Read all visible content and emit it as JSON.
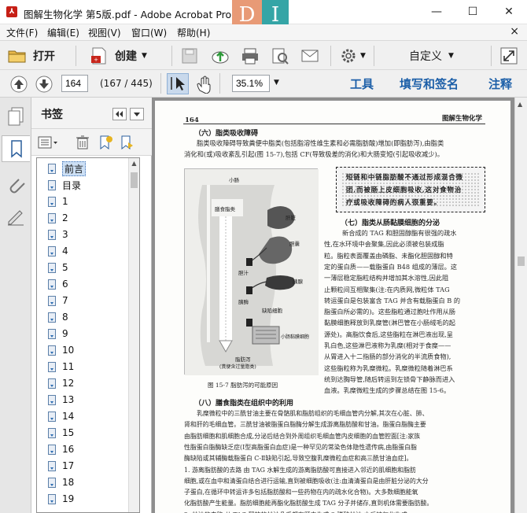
{
  "window": {
    "title": "图解生物化学 第5版.pdf - Adobe Acrobat Pro",
    "deco_left": "D",
    "deco_right": "I",
    "minimize": "—",
    "maximize": "☐",
    "close": "✕"
  },
  "menu": {
    "items": [
      "文件(F)",
      "编辑(E)",
      "视图(V)",
      "窗口(W)",
      "帮助(H)"
    ],
    "close": "×"
  },
  "toolbar": {
    "open_label": "打开",
    "create_label": "创建",
    "customize_label": "自定义"
  },
  "nav": {
    "page_value": "164",
    "page_count": "(167 / 445)",
    "zoom_value": "35.1%",
    "tools_label": "工具",
    "fill_sign_label": "填写和签名",
    "comment_label": "注释"
  },
  "bookmarks": {
    "title": "书签",
    "items": [
      "前言",
      "目录",
      "1",
      "2",
      "3",
      "4",
      "5",
      "6",
      "7",
      "8",
      "9",
      "10",
      "11",
      "12",
      "13",
      "14",
      "15",
      "16",
      "17",
      "18",
      "19"
    ]
  },
  "page": {
    "number": "164",
    "running_head": "图解生物化学",
    "section1_title": "（六）脂类吸收障碍",
    "section1_lines": [
      "脂类吸收障碍导致粪便中脂类(包括脂溶性维生素和必需脂肪酸)增加(即脂肪泻),由脂类",
      "消化和(或)吸收紊乱引起(图 15-7),包括 CF(导致极差的消化)和大肠变短(引起吸收减少)。"
    ],
    "callout_lines": [
      "短链和中链脂肪酸不通过形成混合微",
      "团,而被肠上皮细胞吸收,这对食物治",
      "疗或吸收障碍的病人很重要。"
    ],
    "section7_title": "（七）脂类从肠黏膜细胞的分泌",
    "section7_lines": [
      "新合成的 TAG 和胆固醇酯有很强的疏水",
      "性,在水环境中会聚集,因此必须被包装成脂",
      "粒。脂粒表面覆盖由磷脂、未酯化胆固醇和特",
      "定的蛋白质——载脂蛋白 B48 组成的薄层。这",
      "一薄层稳定脂粒结构并增加其水溶性,因此阻",
      "止颗粒间互相聚集(注:在内质网,微粒体 TAG",
      "转运蛋白是包装富含 TAG 并含有载脂蛋白 B 的",
      "脂蛋白所必需的)。这些脂粒通过胞吐作用从肠",
      "黏膜细胞释放到乳糜管(淋巴管在小肠绒毛的起",
      "源处)。高脂饮食后,这些脂粒在淋巴液出现,呈",
      "乳白色,这些淋巴液称为乳糜(相对于食糜——",
      "从胃进入十二指肠的部分消化的半流质食物),",
      "这些脂粒称为乳糜微粒。乳糜微粒随着淋巴系",
      "统到达胸导管,随后转运到左锁骨下静脉而进入",
      "血液。乳糜微粒生成的步骤总结在图 15-6。"
    ],
    "figure_labels": {
      "small_intestine": "小肠",
      "dietary_fat": "膳食脂类",
      "liver": "肝脏",
      "gallbladder": "胆囊",
      "pancreas": "胰腺",
      "bile": "胆汁",
      "lipase": "胰酶",
      "defective_cell": "缺陷细胞",
      "mucosa": "小肠黏膜细胞",
      "steatorrhea": "脂肪泻",
      "steatorrhea_note": "(粪便含过量脂类)"
    },
    "figure_caption": "图 15-7    脂肪泻的可能原因",
    "section8_title": "（八）膳食脂类在组织中的利用",
    "section8_lines": [
      "乳糜微粒中的三酰甘油主要在骨骼肌和脂肪组织的毛细血管内分解,其次在心脏、肺、",
      "肾和肝的毛细血管。三酰甘油被脂蛋白脂酶分解生成游离脂肪酸和甘油。脂蛋白脂酶主要",
      "由脂肪细胞和肌细胞合成,分泌后结合到外周组织毛细血管内皮细胞的血管腔面[注:家族",
      "性脂蛋白脂酶缺乏症(Ⅰ型高脂蛋白血症)是一种罕见的常染色体隐性遗传病,由脂蛋白脂",
      "酶缺陷或其辅酶载脂蛋白 C-Ⅱ缺陷引起,导致空腹乳糜微粒血症和高三酰甘油血症]。",
      "    1. 游离脂肪酸的去路   由 TAG 水解生成的游离脂肪酸可直接进入邻近的肌细胞和脂肪",
      "细胞,或在血中和清蛋白结合进行运输,直到被细胞吸收(注:血清清蛋白是由肝脏分泌的大分",
      "子蛋白,在循环中转运许多包括脂肪酸和一些药物在内的疏水化合物)。大多数细胞能氧",
      "化脂肪酸产生能量。脂肪细胞能再酯化脂肪酸生成 TAG 分子并储存,直到机体需要脂肪酸。",
      "    2. 甘油的去路   从 TAG 释放的甘油几乎都在肝中生成 3-磷酸甘油,之后被氧化生成"
    ]
  }
}
